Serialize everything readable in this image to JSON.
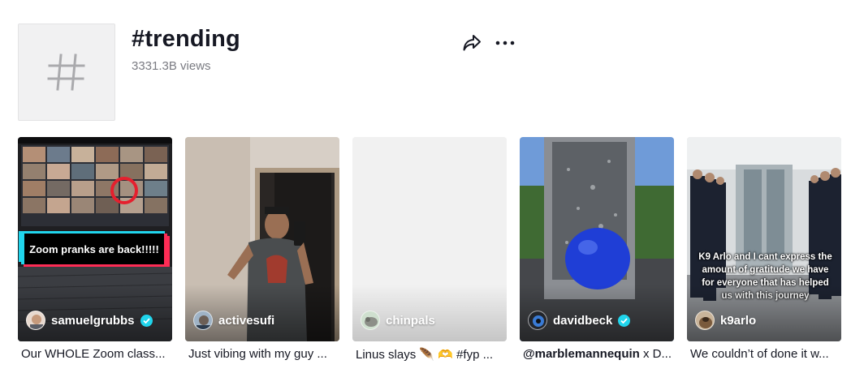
{
  "hashtag": {
    "title": "#trending",
    "views": "3331.3B views",
    "avatar_icon": "hash-icon"
  },
  "actions": {
    "share_icon": "share-icon",
    "more_icon": "more-horizontal-icon"
  },
  "colors": {
    "verified": "#20d5ec",
    "accent_red": "#fe2c55",
    "text_primary": "#161823",
    "text_secondary": "#7a7b82"
  },
  "videos": [
    {
      "creator": "samuelgrubbs",
      "verified": true,
      "overlay_text": "Zoom pranks are back!!!!!",
      "caption": "Our WHOLE Zoom class..."
    },
    {
      "creator": "activesufi",
      "verified": false,
      "caption": "Just vibing with my guy ..."
    },
    {
      "creator": "chinpals",
      "verified": false,
      "caption": "Linus slays 🪶 🫶 #fyp ..."
    },
    {
      "creator": "davidbeck",
      "verified": true,
      "caption_mention": "@marblemannequin",
      "caption_rest": " x D...",
      "caption": "@marblemannequin x D..."
    },
    {
      "creator": "k9arlo",
      "verified": false,
      "overlay_text": "K9 Arlo and I cant express the amount of gratitude we have for everyone that has helped us with this journey",
      "caption": "We couldn’t of done it w..."
    }
  ]
}
